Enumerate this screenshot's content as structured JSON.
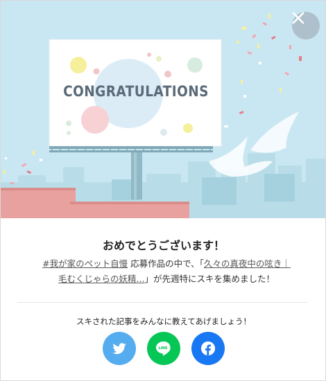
{
  "hero": {
    "billboard_text": "CONGRATULATIONS",
    "close_icon": "close-icon",
    "colors": {
      "sky": "#c9e7f3",
      "buildings_pink": "#e8a19f",
      "buildings_blue": "#b8dde8",
      "billboard_frame": "#7ea8b6"
    }
  },
  "dialog": {
    "title": "おめでとうございます！",
    "hashtag_link": "#我が家のペット自慢",
    "text_before_article": "応募作品の中で、「",
    "article_link_line1": "久々の真夜中の呟き｜",
    "article_link_line2": "毛むくじゃらの妖精...",
    "text_after_article": "」が先週特にスキを集めました！",
    "share_prompt": "スキされた記事をみんなに教えてあげましょう！"
  },
  "share": [
    {
      "name": "twitter",
      "icon": "twitter-icon",
      "color": "#55acee"
    },
    {
      "name": "line",
      "icon": "line-icon",
      "line_label": "LINE",
      "color": "#06c755"
    },
    {
      "name": "facebook",
      "icon": "facebook-icon",
      "color": "#1877f2"
    }
  ]
}
